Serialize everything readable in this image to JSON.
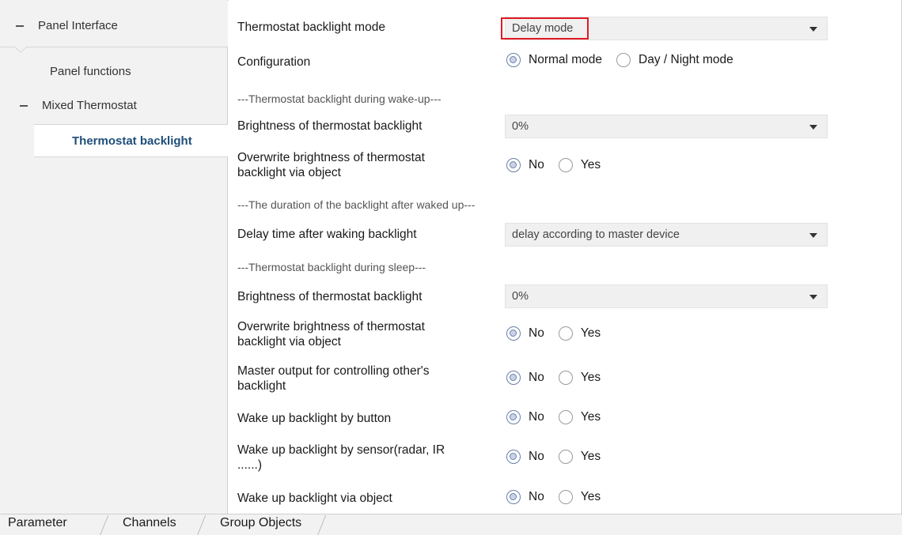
{
  "tree": {
    "root_label": "Panel Interface",
    "panel_functions": "Panel functions",
    "mixed_thermostat": "Mixed Thermostat",
    "selected_item": "Thermostat backlight"
  },
  "params": {
    "backlight_mode": {
      "label": "Thermostat backlight mode",
      "value": "Delay mode"
    },
    "configuration": {
      "label": "Configuration",
      "options": [
        "Normal mode",
        "Day / Night mode"
      ],
      "selected": "Normal mode"
    },
    "section_wake": "---Thermostat backlight during wake-up---",
    "brightness_wake": {
      "label": "Brightness of thermostat backlight",
      "value": "0%"
    },
    "overwrite_wake": {
      "label_line1": "Overwrite brightness of thermostat",
      "label_line2": "backlight  via object",
      "options": [
        "No",
        "Yes"
      ],
      "selected": "No"
    },
    "section_duration": "---The duration of the backlight after waked up---",
    "delay_time": {
      "label": "Delay time after waking backlight",
      "value": "delay according to master device"
    },
    "section_sleep": "---Thermostat backlight during sleep---",
    "brightness_sleep": {
      "label": "Brightness of thermostat backlight",
      "value": "0%"
    },
    "overwrite_sleep": {
      "label_line1": "Overwrite brightness of  thermostat",
      "label_line2": "backlight via object",
      "options": [
        "No",
        "Yes"
      ],
      "selected": "No"
    },
    "master_output": {
      "label_line1": "Master output for controlling other's",
      "label_line2": "backlight",
      "options": [
        "No",
        "Yes"
      ],
      "selected": "No"
    },
    "wake_button": {
      "label": "Wake up backlight by button",
      "options": [
        "No",
        "Yes"
      ],
      "selected": "No"
    },
    "wake_sensor": {
      "label_line1": "Wake up backlight by sensor(radar, IR",
      "label_line2": "......)",
      "options": [
        "No",
        "Yes"
      ],
      "selected": "No"
    },
    "wake_object": {
      "label": "Wake up backlight via object",
      "options": [
        "No",
        "Yes"
      ],
      "selected": "No"
    }
  },
  "tabs": [
    "Parameter",
    "Channels",
    "Group Objects"
  ],
  "colors": {
    "highlight_box": "#e01b24",
    "selected_tree_text": "#1f4e79"
  }
}
